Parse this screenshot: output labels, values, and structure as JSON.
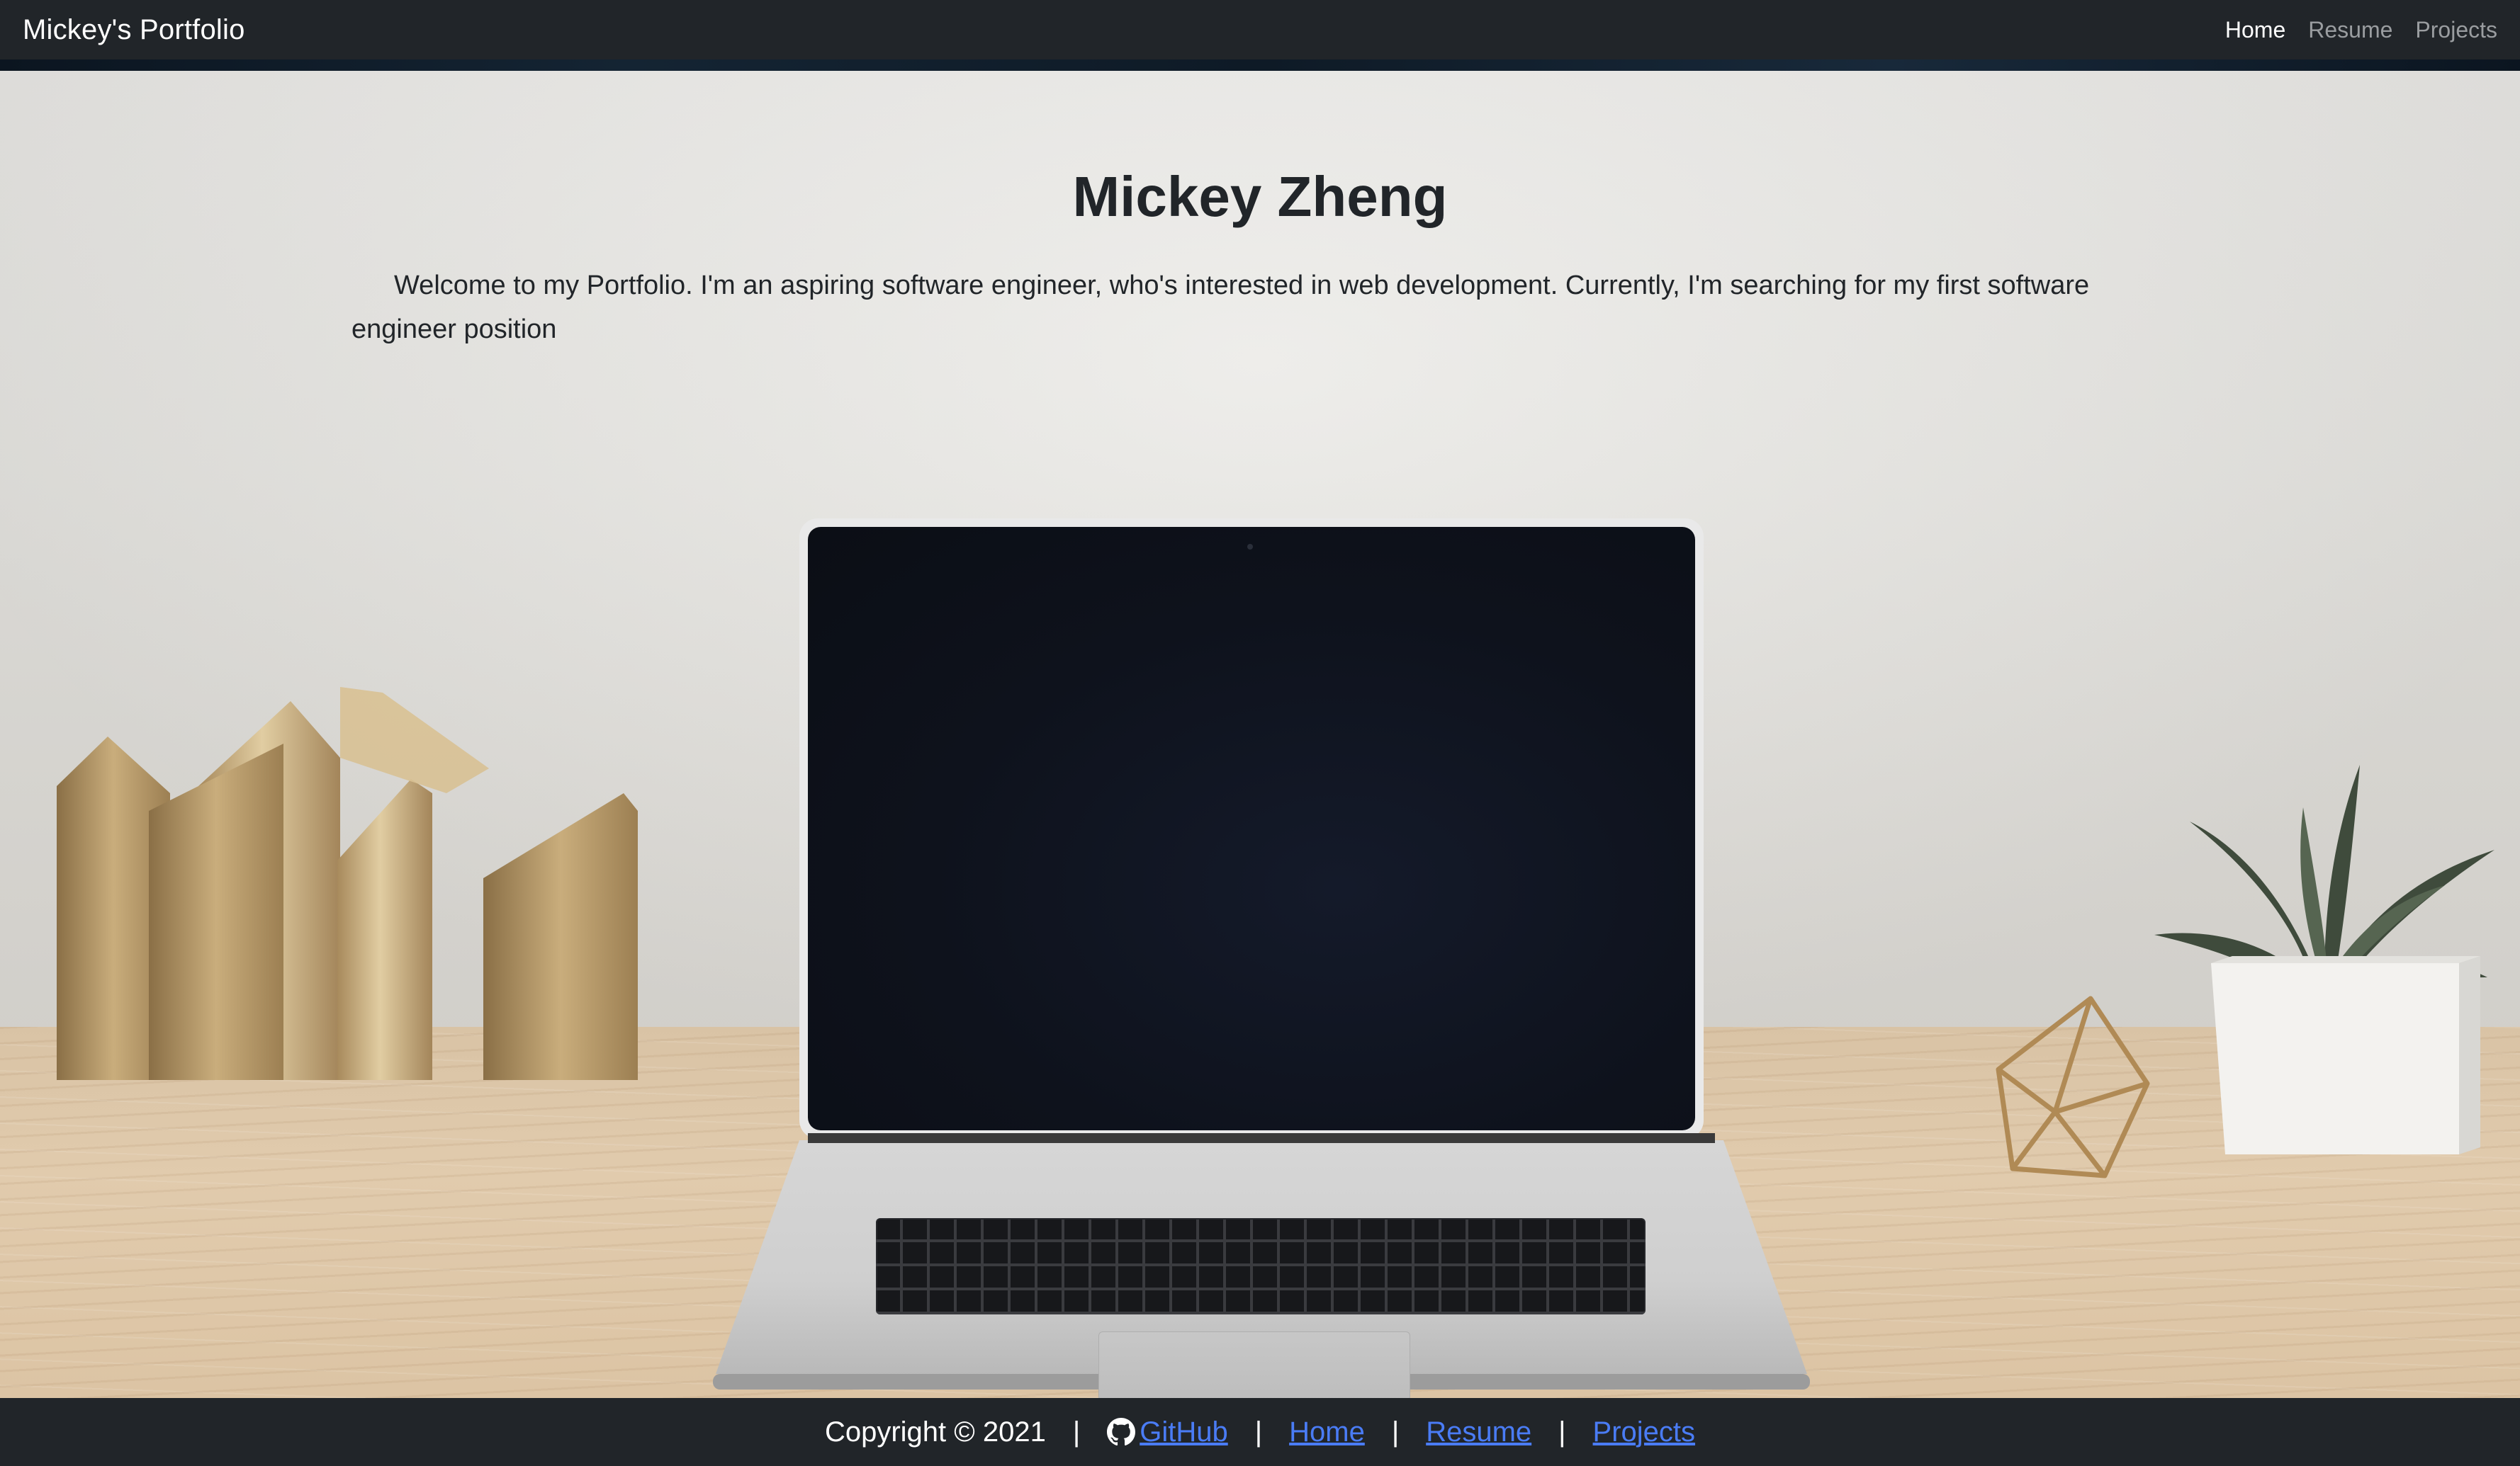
{
  "navbar": {
    "brand": "Mickey's Portfolio",
    "links": [
      {
        "label": "Home",
        "active": true
      },
      {
        "label": "Resume",
        "active": false
      },
      {
        "label": "Projects",
        "active": false
      }
    ]
  },
  "hero": {
    "title": "Mickey Zheng",
    "intro": "Welcome to my Portfolio. I'm an aspiring software engineer, who's interested in web development. Currently, I'm searching for my first software engineer position",
    "background_scene": "laptop on wooden desk with brass bookends, potted succulent and geometric terrarium"
  },
  "footer": {
    "copyright": "Copyright © 2021",
    "separator": "|",
    "github_icon": "github-icon",
    "links": [
      {
        "label": "GitHub"
      },
      {
        "label": "Home"
      },
      {
        "label": "Resume"
      },
      {
        "label": "Projects"
      }
    ]
  },
  "colors": {
    "navbar_bg": "#212529",
    "footer_bg": "#212529",
    "link": "#4a7cf5",
    "nav_inactive": "#9a9da0",
    "title_text": "#212529"
  }
}
